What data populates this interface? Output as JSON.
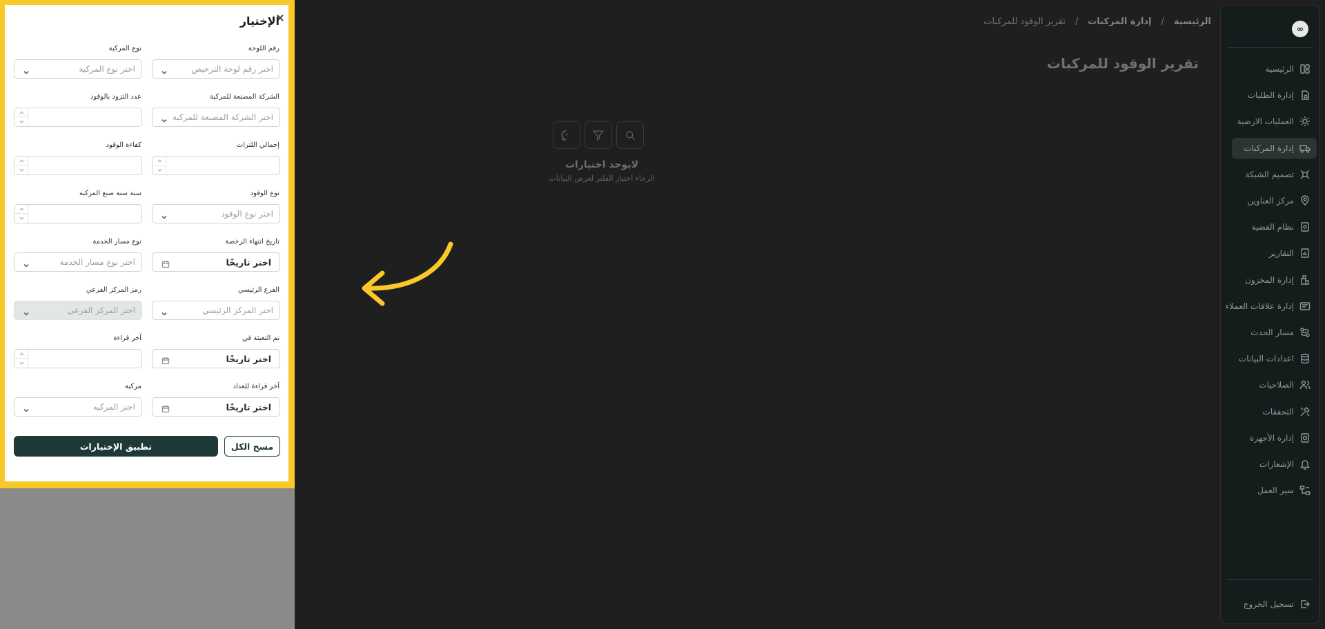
{
  "sidebar": {
    "logo": "∞",
    "items": [
      {
        "label": "الرئيسية",
        "icon": "dashboard-icon"
      },
      {
        "label": "إدارة الطلبات",
        "icon": "orders-icon"
      },
      {
        "label": "العمليات الارضية",
        "icon": "ground-ops-icon"
      },
      {
        "label": "إدارة المركبات",
        "icon": "truck-icon",
        "active": true
      },
      {
        "label": "تصميم الشبكة",
        "icon": "network-icon"
      },
      {
        "label": "مركز العناوين",
        "icon": "location-icon"
      },
      {
        "label": "نظام القضية",
        "icon": "case-icon"
      },
      {
        "label": "التقارير",
        "icon": "reports-icon"
      },
      {
        "label": "إدارة المخزون",
        "icon": "inventory-icon"
      },
      {
        "label": "إدارة علاقات العملاء",
        "icon": "crm-icon"
      },
      {
        "label": "مسار الحدث",
        "icon": "event-path-icon"
      },
      {
        "label": "اعدادات البيانات",
        "icon": "database-icon"
      },
      {
        "label": "الصلاحيات",
        "icon": "users-icon"
      },
      {
        "label": "التحققات",
        "icon": "tools-icon"
      },
      {
        "label": "إدارة الأجهزة",
        "icon": "device-icon"
      },
      {
        "label": "الإشعارات",
        "icon": "bell-icon"
      },
      {
        "label": "سير العمل",
        "icon": "workflow-icon"
      }
    ],
    "logout_label": "تسجيل الخروج"
  },
  "breadcrumb": {
    "home": "الرئيسية",
    "section": "إدارة المركبات",
    "current": "تقرير الوقود للمركبات",
    "separator": "/"
  },
  "page": {
    "title": "تقرير الوقود للمركبات",
    "empty_title": "لايوجد اختيارات",
    "empty_subtitle": "الرجاء اختيار الفلتر لعرض البيانات"
  },
  "drawer": {
    "title": "الإختيار",
    "fields": {
      "plate": {
        "label": "رقم اللوحة",
        "placeholder": "اختر رقم لوحة الترخيص"
      },
      "vehicle_type": {
        "label": "نوع المركبة",
        "placeholder": "اختر نوع المركبة"
      },
      "manufacturer": {
        "label": "الشركة المصنعة للمركبة",
        "placeholder": "اختر الشركة المصنعة للمركبة"
      },
      "refuel_count": {
        "label": "عدد التزود بالوقود",
        "value": ""
      },
      "total_liters": {
        "label": "إجمالي اللترات",
        "value": ""
      },
      "fuel_efficiency": {
        "label": "كفاءة الوقود",
        "value": ""
      },
      "fuel_type": {
        "label": "نوع الوقود",
        "placeholder": "اختر نوع الوقود"
      },
      "manufacture_year": {
        "label": "سنة سنة صنع المركبة",
        "value": ""
      },
      "license_expiry": {
        "label": "تاريخ انتهاء الرخصة",
        "placeholder": "اختر تاريخًا"
      },
      "service_route": {
        "label": "نوع مسار الخدمة",
        "placeholder": "اختر نوع مسار الخدمة"
      },
      "main_branch": {
        "label": "الفرع الرئيسي",
        "placeholder": "اختر المركز الرئيسي"
      },
      "sub_center": {
        "label": "رمز المركز الفرعي",
        "placeholder": "اختر المركز الفرعي"
      },
      "filled_on": {
        "label": "تم التعبئة في",
        "placeholder": "اختر تاريخًا"
      },
      "last_reading": {
        "label": "آخر قراءة",
        "value": ""
      },
      "last_meter_reading": {
        "label": "آخر قراءة للعداد",
        "placeholder": "اختر تاريخًا"
      },
      "vehicle": {
        "label": "مركبة",
        "placeholder": "اختر المركبه"
      }
    },
    "clear_label": "مسح الكل",
    "apply_label": "تطبيق الإختيارات"
  },
  "colors": {
    "highlight": "#f9c92a",
    "primary": "#1f3838",
    "overlay": "#1f1f1f"
  }
}
